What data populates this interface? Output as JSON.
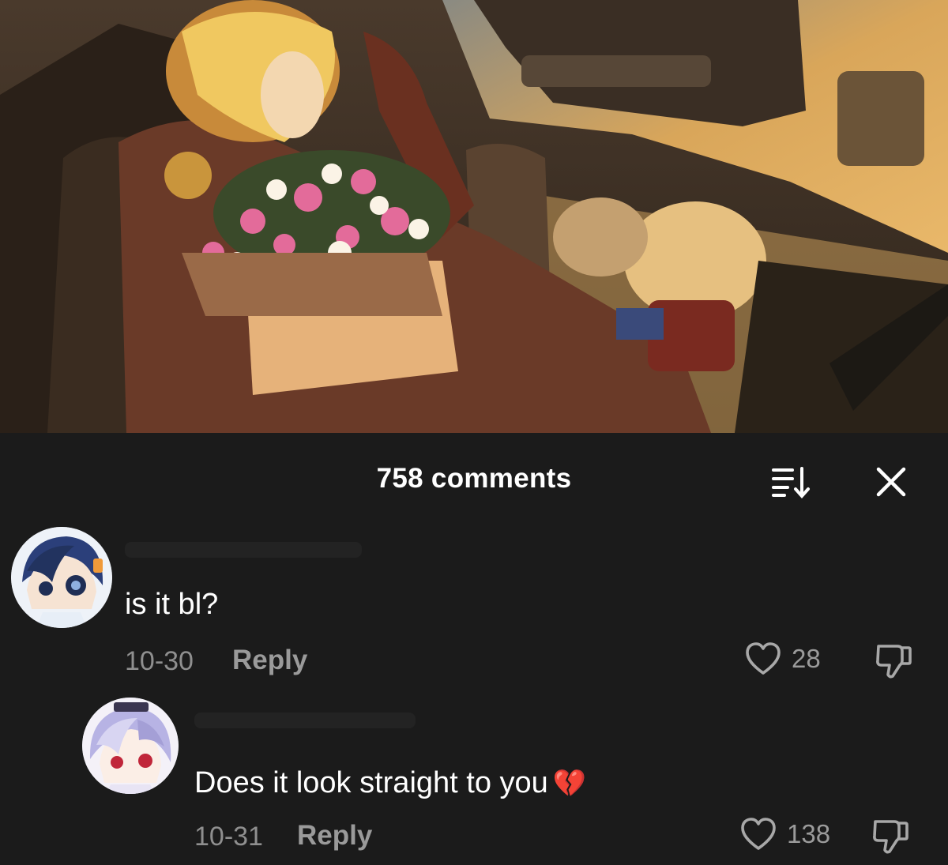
{
  "header": {
    "comment_count": "758 comments",
    "sort_icon": "sort-icon",
    "close_icon": "close-icon"
  },
  "comments": [
    {
      "avatar": "avatar-dark-blue-hair",
      "text": "is it bl?",
      "date": "10-30",
      "reply_label": "Reply",
      "likes": "28"
    },
    {
      "avatar": "avatar-white-hair",
      "text": "Does it look straight to you",
      "emoji": "💔",
      "date": "10-31",
      "reply_label": "Reply",
      "likes": "138"
    }
  ],
  "colors": {
    "background": "#1b1b1b",
    "text_primary": "#ffffff",
    "text_secondary": "#8f8f8f"
  }
}
